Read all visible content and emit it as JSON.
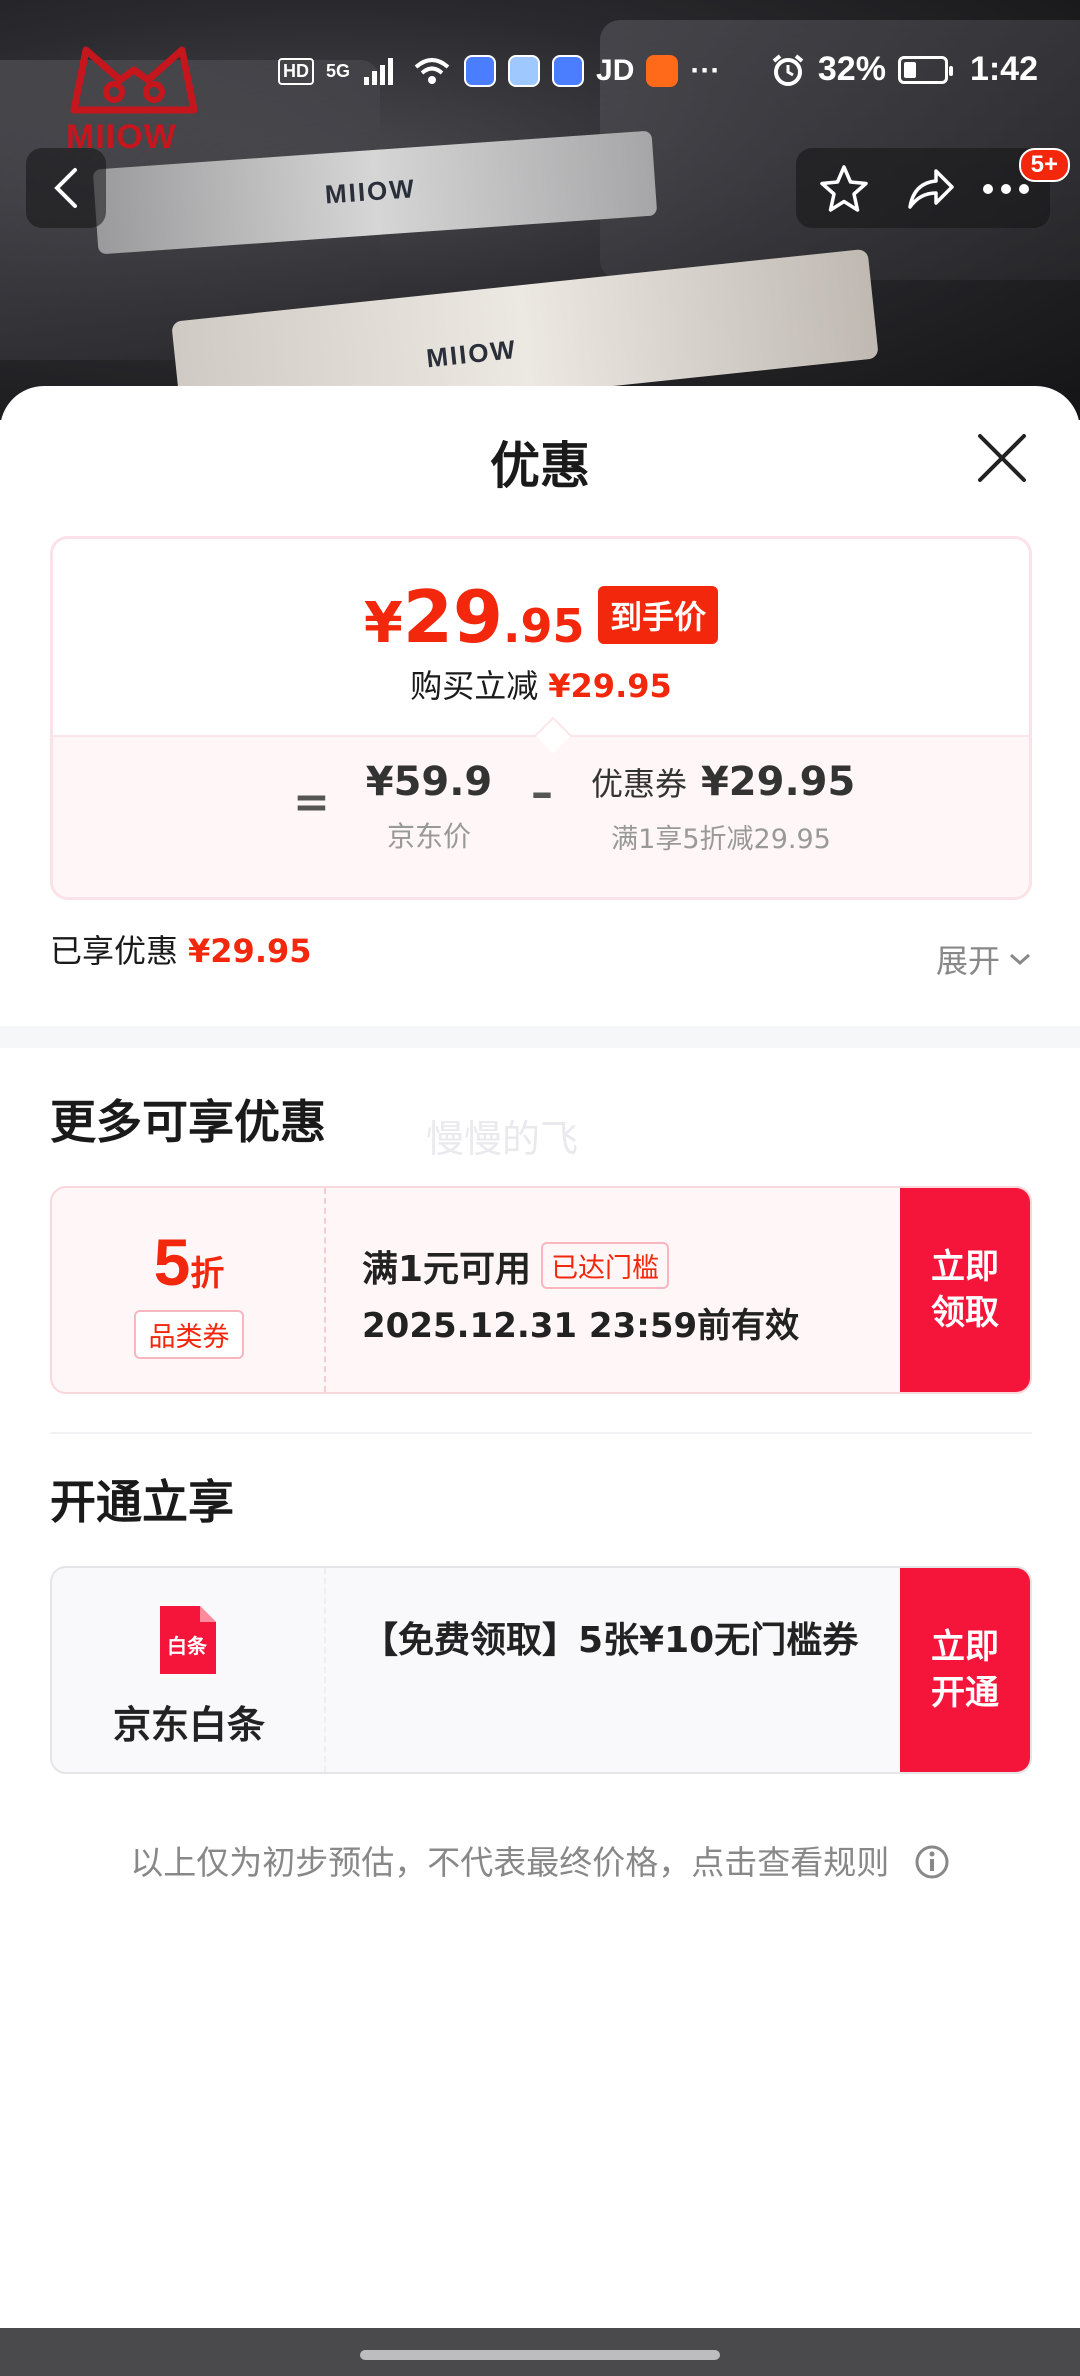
{
  "status_bar": {
    "network_badge": "HD",
    "network_type": "5G",
    "app_text": "JD",
    "more": "···",
    "battery_percent": "32%",
    "battery_level": 0.32,
    "time": "1:42"
  },
  "hero": {
    "brand": "MIIOW",
    "band_text": "MIIOW"
  },
  "nav": {
    "cart_badge": "5+"
  },
  "sheet": {
    "title": "优惠"
  },
  "price_card": {
    "yen": "¥",
    "price_int": "29",
    "price_dec": ".95",
    "final_tag": "到手价",
    "instant_label": "购买立减",
    "instant_value": "¥29.95",
    "equals": "=",
    "jd_price": "¥59.9",
    "jd_price_label": "京东价",
    "minus": "–",
    "coupon_prefix": "优惠券",
    "coupon_value": "¥29.95",
    "coupon_rule": "满1享5折减29.95"
  },
  "enjoyed": {
    "label": "已享优惠",
    "value": "¥29.95",
    "expand": "展开"
  },
  "more_offers": {
    "title": "更多可享优惠",
    "watermark": "慢慢的飞",
    "coupon": {
      "discount_num": "5",
      "discount_unit": "折",
      "category": "品类券",
      "condition": "满1元可用",
      "status": "已达门槛",
      "validity": "2025.12.31 23:59前有效",
      "cta": "立即领取"
    }
  },
  "open_enjoy": {
    "title": "开通立享",
    "card": {
      "icon_text": "白条",
      "name": "京东白条",
      "desc": "【免费领取】5张¥10无门槛券",
      "cta": "立即开通"
    }
  },
  "footer": {
    "note": "以上仅为初步预估，不代表最终价格，点击查看规则"
  },
  "colors": {
    "accent_red": "#f2270c",
    "cta_red": "#f5143a"
  }
}
